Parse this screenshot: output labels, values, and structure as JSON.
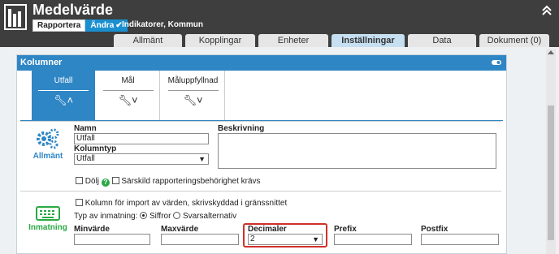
{
  "header": {
    "title": "Medelvärde",
    "mode_report": "Rapportera",
    "mode_edit": "Ändra",
    "subtitle": "Indikatorer, Kommun",
    "collapse_glyph": "⌃"
  },
  "tabs": [
    {
      "label": "Allmänt",
      "active": false
    },
    {
      "label": "Kopplingar",
      "active": false
    },
    {
      "label": "Enheter",
      "active": false
    },
    {
      "label": "Inställningar",
      "active": true
    },
    {
      "label": "Data",
      "active": false
    },
    {
      "label": "Dokument (0)",
      "active": false
    }
  ],
  "panel": {
    "title": "Kolumner",
    "column_tabs": [
      {
        "label": "Utfall",
        "active": true
      },
      {
        "label": "Mål",
        "active": false
      },
      {
        "label": "Måluppfyllnad",
        "active": false
      }
    ]
  },
  "general": {
    "section_label": "Allmänt",
    "name_label": "Namn",
    "name_value": "Utfall",
    "type_label": "Kolumntyp",
    "type_value": "Utfall",
    "desc_label": "Beskrivning",
    "desc_value": "",
    "hide_label": "Dölj",
    "special_label": "Särskild rapporteringsbehörighet krävs"
  },
  "input": {
    "section_label": "Inmatning",
    "import_label": "Kolumn för import av värden, skrivskyddad i gränssnittet",
    "input_type_label": "Typ av inmatning:",
    "radio_digits": "Siffror",
    "radio_answers": "Svarsalternativ",
    "min_label": "Minvärde",
    "max_label": "Maxvärde",
    "decimals_label": "Decimaler",
    "decimals_value": "2",
    "prefix_label": "Prefix",
    "postfix_label": "Postfix"
  },
  "colors": {
    "header_bg": "#3e3e3e",
    "accent_blue": "#2f86c5",
    "accent_green": "#2aa845",
    "highlight_red": "#d0302a"
  }
}
